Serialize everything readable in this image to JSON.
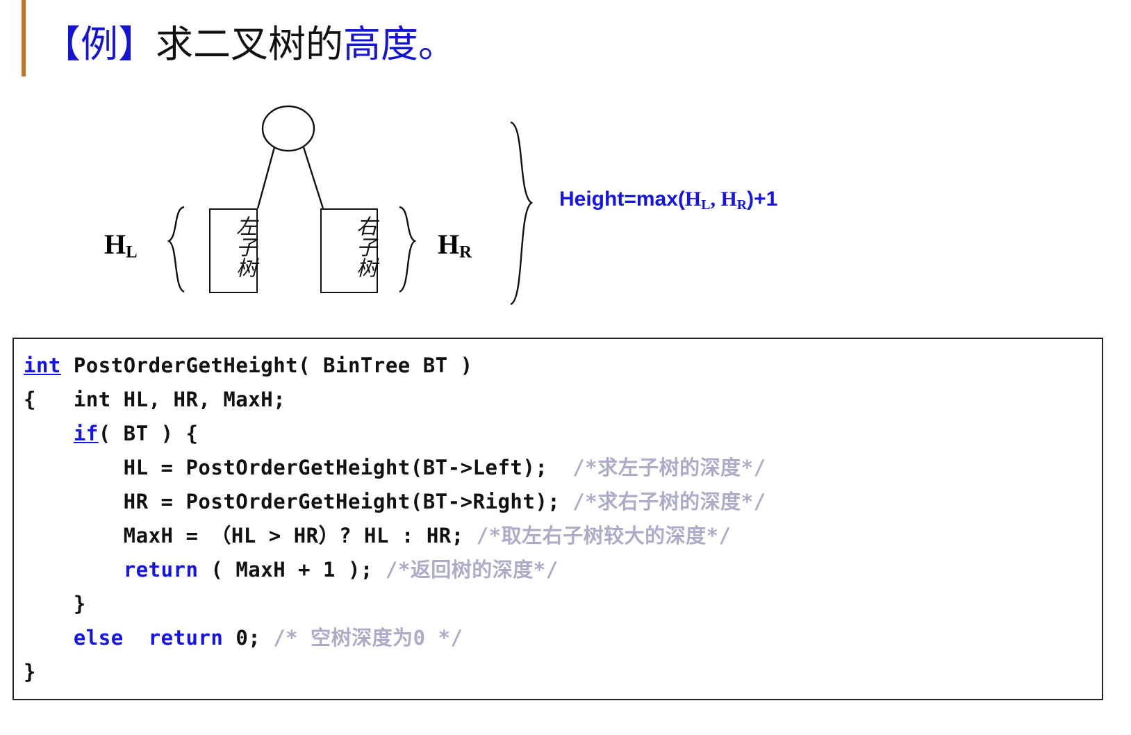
{
  "slide": {
    "accent_color": "#C07428",
    "title": {
      "bracket_open_example": "【例】",
      "middle_black": "求二叉树的",
      "tail_blue": "高度。",
      "full_text": "【例】求二叉树的高度。"
    }
  },
  "diagram": {
    "root_node_label": "",
    "left_subtree_label": "左子树",
    "right_subtree_label": "右子树",
    "height_left_label": "H",
    "height_left_sub": "L",
    "height_right_label": "H",
    "height_right_sub": "R",
    "formula": {
      "prefix": "Height=max(",
      "h_left": "H",
      "h_left_sub": "L",
      "separator": ", ",
      "h_right": "H",
      "h_right_sub": "R",
      "suffix": ")+1",
      "color": "#1414E6",
      "full_text": "Height=max(HL, HR)+1"
    }
  },
  "code": {
    "language": "C",
    "keyword_color": "#1414E6",
    "comment_color": "#ACACC8",
    "text_color": "#111111",
    "lines": [
      {
        "segments": [
          {
            "t": "int",
            "c": "kw"
          },
          {
            "t": " PostOrderGetHeight( BinTree BT )",
            "c": "tx"
          }
        ]
      },
      {
        "segments": [
          {
            "t": "{   int HL, HR, MaxH;",
            "c": "tx"
          }
        ]
      },
      {
        "segments": [
          {
            "t": "    ",
            "c": "tx"
          },
          {
            "t": "if",
            "c": "kw"
          },
          {
            "t": "( BT ) {",
            "c": "tx"
          }
        ]
      },
      {
        "segments": [
          {
            "t": "        HL = PostOrderGetHeight(BT->Left);  ",
            "c": "tx"
          },
          {
            "t": "/*求左子树的深度*/",
            "c": "cm"
          }
        ]
      },
      {
        "segments": [
          {
            "t": "        HR = PostOrderGetHeight(BT->Right); ",
            "c": "tx"
          },
          {
            "t": "/*求右子树的深度*/",
            "c": "cm"
          }
        ]
      },
      {
        "segments": [
          {
            "t": "        MaxH = （HL > HR）? HL : HR; ",
            "c": "tx"
          },
          {
            "t": "/*取左右子树较大的深度*/",
            "c": "cm"
          }
        ]
      },
      {
        "segments": [
          {
            "t": "        ",
            "c": "tx"
          },
          {
            "t": "return",
            "c": "kwp"
          },
          {
            "t": " ( MaxH + 1 ); ",
            "c": "tx"
          },
          {
            "t": "/*返回树的深度*/",
            "c": "cm"
          }
        ]
      },
      {
        "segments": [
          {
            "t": "    }",
            "c": "tx"
          }
        ]
      },
      {
        "segments": [
          {
            "t": "    ",
            "c": "tx"
          },
          {
            "t": "else",
            "c": "kwp"
          },
          {
            "t": "  ",
            "c": "tx"
          },
          {
            "t": "return",
            "c": "kwp"
          },
          {
            "t": " 0; ",
            "c": "tx"
          },
          {
            "t": "/* 空树深度为0 */",
            "c": "cm"
          }
        ]
      },
      {
        "segments": [
          {
            "t": "}",
            "c": "tx"
          }
        ]
      }
    ]
  }
}
